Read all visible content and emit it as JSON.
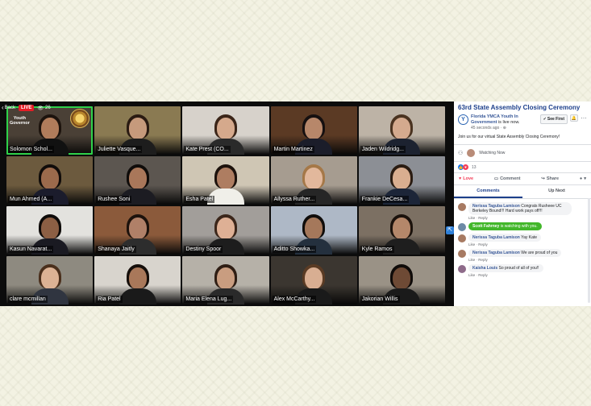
{
  "video": {
    "back_label": "Back",
    "live_label": "LIVE",
    "viewer_count": "26",
    "tiles": [
      {
        "name": "Solomon Schol...",
        "bg": "#4a4036",
        "skin": "#b07c5b",
        "hair": "#1c130d",
        "shirt": "#111111",
        "active": true,
        "overlay": "Youth\nGovernor"
      },
      {
        "name": "Juliette Vasque...",
        "bg": "#8a7a52",
        "skin": "#c69a7c",
        "hair": "#2a1b12",
        "shirt": "#1d1d1d"
      },
      {
        "name": "Kate Prest (CO...",
        "bg": "#d7d2cb",
        "skin": "#d5a98c",
        "hair": "#3b2518",
        "shirt": "#2a2a2a"
      },
      {
        "name": "Martin Martinez",
        "bg": "#5b3a24",
        "skin": "#b7876a",
        "hair": "#161010",
        "shirt": "#1b1d2a"
      },
      {
        "name": "Jaden Wildridg...",
        "bg": "#bdb3a6",
        "skin": "#d4aa8e",
        "hair": "#4a3320",
        "shirt": "#1c2230"
      },
      {
        "name": "Mun Ahmed (A...",
        "bg": "#6c5a3e",
        "skin": "#9b6a4c",
        "hair": "#100c0a",
        "shirt": "#1b1c2c"
      },
      {
        "name": "Rushee Soni",
        "bg": "#5c5650",
        "skin": "#a9775a",
        "hair": "#0f0c0a",
        "shirt": "#1c1c22"
      },
      {
        "name": "Esha Patel",
        "bg": "#cfc6b4",
        "skin": "#ae7d61",
        "hair": "#1d120c",
        "shirt": "#f0efe9"
      },
      {
        "name": "Allyssa Ruther...",
        "bg": "#a69c90",
        "skin": "#e2b89c",
        "hair": "#a57848",
        "shirt": "#262626"
      },
      {
        "name": "Frankie DeCesa...",
        "bg": "#8c8f95",
        "skin": "#d9ae90",
        "hair": "#2a1c12",
        "shirt": "#1c2538"
      },
      {
        "name": "Kasun Navarat...",
        "bg": "#e3e2de",
        "skin": "#8c5f44",
        "hair": "#0e0b09",
        "shirt": "#1a1a22"
      },
      {
        "name": "Shanaya Jaitly",
        "bg": "#8b5a3b",
        "skin": "#b08068",
        "hair": "#1c120c",
        "shirt": "#2d2d2d"
      },
      {
        "name": "Destiny Spoor",
        "bg": "#a29e9a",
        "skin": "#deb095",
        "hair": "#3b261a",
        "shirt": "#1d1d1d"
      },
      {
        "name": "Aditto Showka...",
        "bg": "#aeb8c6",
        "skin": "#a5785b",
        "hair": "#100d0b",
        "shirt": "#24303e"
      },
      {
        "name": "Kyle Ramos",
        "bg": "#7c7063",
        "skin": "#b4876a",
        "hair": "#1b120c",
        "shirt": "#1e1e1e"
      },
      {
        "name": "clare mcmillan",
        "bg": "#8e8a80",
        "skin": "#dcb294",
        "hair": "#4a2f1c",
        "shirt": "#303540"
      },
      {
        "name": "Ria Patel",
        "bg": "#d8d4cd",
        "skin": "#a9785a",
        "hair": "#150e0a",
        "shirt": "#1a1a1a"
      },
      {
        "name": "Maria Elena Lug...",
        "bg": "#b6b1a8",
        "skin": "#c99d80",
        "hair": "#2f1e14",
        "shirt": "#2a2a2a"
      },
      {
        "name": "Alex McCarthy...",
        "bg": "#3b3630",
        "skin": "#d8ae92",
        "hair": "#5a3b24",
        "shirt": "#1a1a1a"
      },
      {
        "name": "Jakorian Willis",
        "bg": "#9a9286",
        "skin": "#6e4a35",
        "hair": "#0f0b09",
        "shirt": "#1a1a1a"
      }
    ]
  },
  "sidebar": {
    "title": "63rd State Assembly Closing Ceremony",
    "page_name": "Florida YMCA Youth In Government",
    "page_status": "is live now.",
    "posted_time": "45 seconds ago",
    "see_first_label": "See First",
    "description": "Join us for our virtual State Assembly Closing Ceremony!",
    "watching_label": "Watching Now",
    "reaction_count": "13",
    "actions": {
      "love": "Love",
      "comment": "Comment",
      "share": "Share"
    },
    "tabs": {
      "comments": "Comments",
      "up_next": "Up Next"
    },
    "comments": [
      {
        "author": "Nerissa Taguba Lamison",
        "text": "Congrats Rusheee UC Berkeley Bound!!! Hard work pays off!!!",
        "meta": "Like · Reply",
        "avatar": "#a77a62"
      },
      {
        "author": "Scott Fahrney",
        "text": "is watching with you.",
        "meta": "",
        "avatar": "#6d8aa6",
        "highlight": true
      },
      {
        "author": "Nerissa Taguba Lamison",
        "text": "Yay Kate",
        "meta": "Like · Reply",
        "avatar": "#a77a62"
      },
      {
        "author": "Nerissa Taguba Lamison",
        "text": "We are proud of you",
        "meta": "Like · Reply",
        "avatar": "#a77a62"
      },
      {
        "author": "Kaisha Louis",
        "text": "So proud of all of you!!",
        "meta": "Like · Reply",
        "avatar": "#8e6b8a"
      }
    ]
  },
  "colors": {
    "live": "#e41e26",
    "active_speaker": "#2fd14a",
    "fb_blue": "#1c3f8b",
    "love": "#f33e58"
  }
}
